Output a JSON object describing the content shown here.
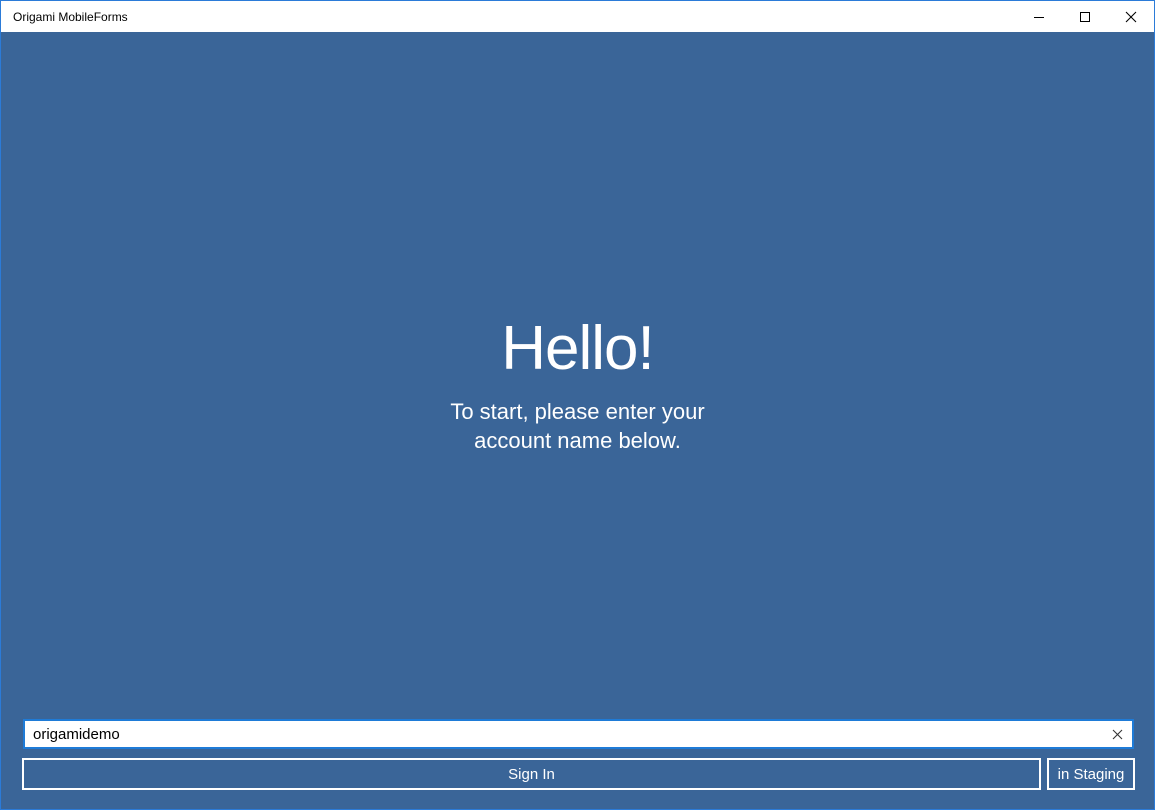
{
  "window": {
    "title": "Origami MobileForms",
    "controls": {
      "minimize_icon": "minimize-icon",
      "maximize_icon": "maximize-icon",
      "close_icon": "close-icon"
    }
  },
  "main": {
    "heading": "Hello!",
    "subtitle_line1": "To start, please enter your",
    "subtitle_line2": "account name below."
  },
  "form": {
    "account_value": "origamidemo",
    "account_placeholder": "",
    "clear_icon": "clear-icon",
    "sign_in_label": "Sign In",
    "staging_label": "in Staging"
  },
  "colors": {
    "background": "#3a6598",
    "input_border": "#1e7bd7",
    "window_border": "#2b7bd8",
    "text": "#ffffff"
  }
}
